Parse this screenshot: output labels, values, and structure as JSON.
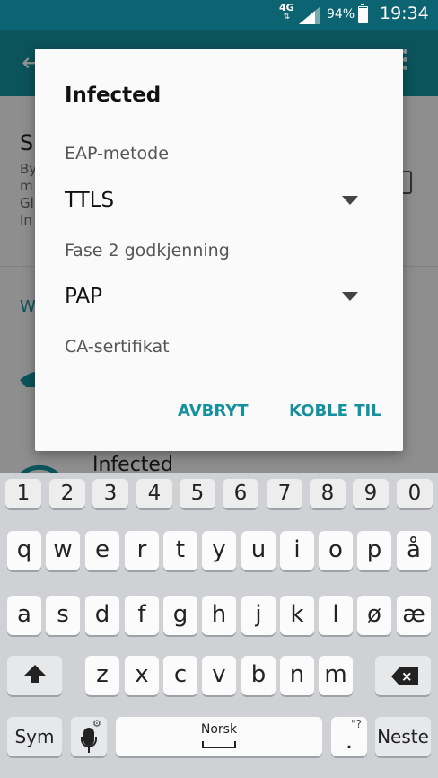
{
  "status_bar": {
    "network_type": "4G",
    "network_activity": "⇅",
    "battery_percent": "94%",
    "battery_level": 0.94,
    "time": "19:34"
  },
  "app_bar": {
    "back_icon": "arrow-back-icon",
    "more_icon": "more-vert-icon"
  },
  "background": {
    "section_title": "S",
    "section_sub": [
      "By",
      "m",
      "Gl",
      "In"
    ],
    "wifi_label": "W",
    "network_name": "Infected"
  },
  "dialog": {
    "title": "Infected",
    "eap_label": "EAP-metode",
    "eap_value": "TTLS",
    "phase2_label": "Fase 2 godkjenning",
    "phase2_value": "PAP",
    "ca_label": "CA-sertifikat",
    "cancel_label": "AVBRYT",
    "connect_label": "KOBLE TIL"
  },
  "keyboard": {
    "numbers": [
      "1",
      "2",
      "3",
      "4",
      "5",
      "6",
      "7",
      "8",
      "9",
      "0"
    ],
    "row1": [
      "q",
      "w",
      "e",
      "r",
      "t",
      "y",
      "u",
      "i",
      "o",
      "p",
      "å"
    ],
    "row2": [
      "a",
      "s",
      "d",
      "f",
      "g",
      "h",
      "j",
      "k",
      "l",
      "ø",
      "æ"
    ],
    "row3": [
      "z",
      "x",
      "c",
      "v",
      "b",
      "n",
      "m"
    ],
    "sym_label": "Sym",
    "space_label": "Norsk",
    "dot_label": ".",
    "dot_alt": "\"?",
    "next_label": "Neste",
    "settings_glyph": "⚙"
  },
  "colors": {
    "status_bar": "#0c6472",
    "app_bar": "#14919e",
    "accent": "#14919e",
    "keyboard_bg": "#cfd1d4"
  }
}
